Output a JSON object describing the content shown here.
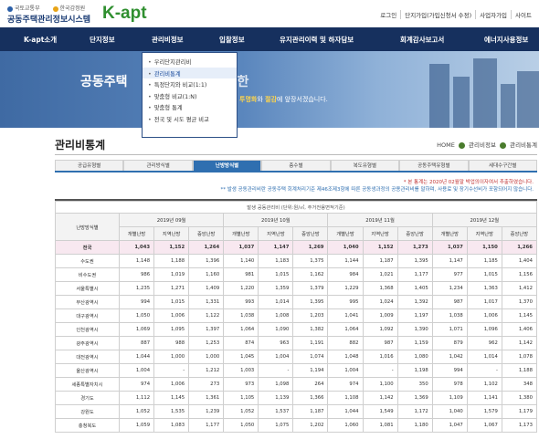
{
  "header": {
    "org1": "국토교통부",
    "org2": "한국감정원",
    "system_name": "공동주택관리정보시스템",
    "brand": "K-apt",
    "util_links": [
      "로그인",
      "단지가입(가입신청서 수정)",
      "사업자가입",
      "사이트"
    ]
  },
  "gnb": {
    "items": [
      "K-apt소개",
      "단지정보",
      "관리비정보",
      "입찰정보",
      "유지관리이력 및 하자담보",
      "회계감사보고서",
      "에너지사용정보"
    ]
  },
  "dropdown": {
    "items": [
      "우리단지관리비",
      "관리비통계",
      "특정단지와 비교(1:1)",
      "맞춤형 비교(1:N)",
      "맞춤형 통계",
      "전국 및 시도 평균 비교"
    ],
    "active_index": 1
  },
  "banner": {
    "title": "공동주택",
    "title_tail": "한",
    "sub_prefix": "",
    "sub_b1": "투명화",
    "sub_mid": "와 ",
    "sub_b2": "절감",
    "sub_suffix": "에 앞장서겠습니다."
  },
  "page": {
    "title": "관리비통계",
    "breadcrumb": [
      "HOME",
      "관리비정보",
      "관리비통계"
    ]
  },
  "tabs": {
    "items": [
      "공급유형별",
      "관리방식별",
      "난방방식별",
      "층수별",
      "복도유형별",
      "공동주택유형별",
      "세대수구간별"
    ],
    "active_index": 2
  },
  "notes": {
    "n1": "* 본 통계는 2020년 02월말 박업의이자여서 추출하였습니다.",
    "n2": "** 발생 공동관리비란 공동주택 회계처리기준 제46조제3항에 따른 공동생과정의 공용관리비를 말하며, 사용료 및 장기수선비가 포함되어지 않습니다."
  },
  "table": {
    "unit_caption": "발생 공동관리비 (단위:원/㎡, 주거전용면적기준)",
    "row_header": "난방방식별",
    "months": [
      "2019년 09월",
      "2019년 10월",
      "2019년 11월",
      "2019년 12월"
    ],
    "sub_headers": [
      "개별난방",
      "지역난방",
      "중앙난방"
    ],
    "rows": [
      {
        "name": "전국",
        "values": [
          "1,043",
          "1,152",
          "1,264",
          "1,037",
          "1,147",
          "1,269",
          "1,040",
          "1,152",
          "1,273",
          "1,037",
          "1,150",
          "1,266"
        ],
        "highlight": true
      },
      {
        "name": "수도권",
        "values": [
          "1,148",
          "1,188",
          "1,396",
          "1,140",
          "1,183",
          "1,375",
          "1,144",
          "1,187",
          "1,395",
          "1,147",
          "1,185",
          "1,404"
        ]
      },
      {
        "name": "비수도권",
        "values": [
          "986",
          "1,019",
          "1,160",
          "981",
          "1,015",
          "1,162",
          "984",
          "1,021",
          "1,177",
          "977",
          "1,015",
          "1,156"
        ]
      },
      {
        "name": "서울특별시",
        "values": [
          "1,235",
          "1,271",
          "1,409",
          "1,220",
          "1,359",
          "1,379",
          "1,229",
          "1,368",
          "1,405",
          "1,234",
          "1,363",
          "1,412"
        ]
      },
      {
        "name": "부산광역시",
        "values": [
          "994",
          "1,015",
          "1,331",
          "993",
          "1,014",
          "1,395",
          "995",
          "1,024",
          "1,392",
          "987",
          "1,017",
          "1,370"
        ]
      },
      {
        "name": "대구광역시",
        "values": [
          "1,050",
          "1,006",
          "1,122",
          "1,038",
          "1,008",
          "1,203",
          "1,041",
          "1,009",
          "1,197",
          "1,038",
          "1,006",
          "1,145"
        ]
      },
      {
        "name": "인천광역시",
        "values": [
          "1,069",
          "1,095",
          "1,397",
          "1,064",
          "1,090",
          "1,382",
          "1,064",
          "1,092",
          "1,390",
          "1,071",
          "1,096",
          "1,406"
        ]
      },
      {
        "name": "광주광역시",
        "values": [
          "887",
          "988",
          "1,253",
          "874",
          "963",
          "1,191",
          "882",
          "987",
          "1,159",
          "879",
          "962",
          "1,142"
        ]
      },
      {
        "name": "대전광역시",
        "values": [
          "1,044",
          "1,000",
          "1,000",
          "1,045",
          "1,004",
          "1,074",
          "1,048",
          "1,016",
          "1,080",
          "1,042",
          "1,014",
          "1,078"
        ]
      },
      {
        "name": "울산광역시",
        "values": [
          "1,004",
          "-",
          "1,212",
          "1,003",
          "-",
          "1,194",
          "1,004",
          "-",
          "1,198",
          "994",
          "-",
          "1,188"
        ]
      },
      {
        "name": "세종특별자치시",
        "values": [
          "974",
          "1,006",
          "273",
          "973",
          "1,098",
          "264",
          "974",
          "1,100",
          "350",
          "978",
          "1,102",
          "348"
        ]
      },
      {
        "name": "경기도",
        "values": [
          "1,112",
          "1,145",
          "1,361",
          "1,105",
          "1,139",
          "1,366",
          "1,108",
          "1,142",
          "1,369",
          "1,109",
          "1,141",
          "1,380"
        ]
      },
      {
        "name": "강원도",
        "values": [
          "1,052",
          "1,535",
          "1,239",
          "1,052",
          "1,537",
          "1,187",
          "1,044",
          "1,549",
          "1,172",
          "1,040",
          "1,579",
          "1,179"
        ]
      },
      {
        "name": "충청북도",
        "values": [
          "1,059",
          "1,083",
          "1,177",
          "1,050",
          "1,075",
          "1,202",
          "1,060",
          "1,081",
          "1,180",
          "1,047",
          "1,067",
          "1,173"
        ]
      }
    ]
  },
  "colors": {
    "gnb_bg": "#16305e",
    "accent_blue": "#2f6fb0",
    "brand_green": "#2f8f2f",
    "highlight_row": "#f8e8f0"
  }
}
